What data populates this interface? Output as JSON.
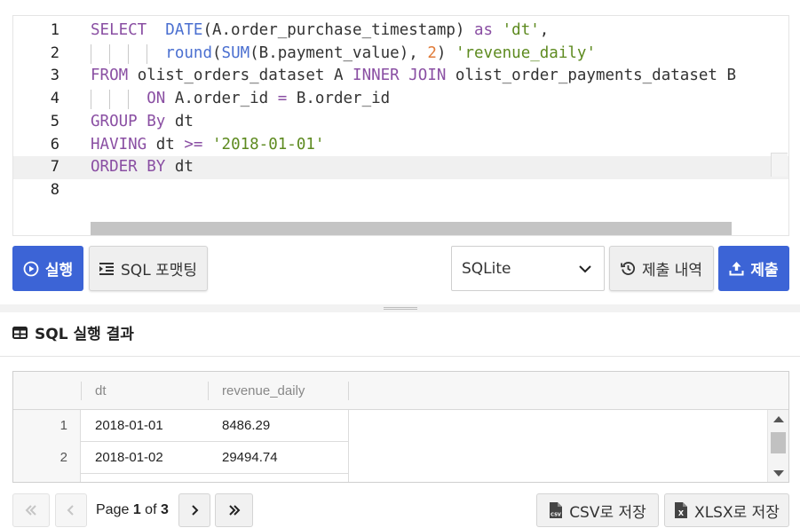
{
  "editor": {
    "active_line": 7,
    "lines": [
      {
        "num": "1",
        "tokens": [
          [
            "kw",
            "SELECT"
          ],
          [
            "",
            "  "
          ],
          [
            "fn",
            "DATE"
          ],
          [
            "",
            "(A.order_purchase_timestamp) "
          ],
          [
            "kw",
            "as"
          ],
          [
            "",
            " "
          ],
          [
            "str",
            "'dt'"
          ],
          [
            "",
            ","
          ]
        ],
        "guides": 0
      },
      {
        "num": "2",
        "tokens": [
          [
            "",
            "        "
          ],
          [
            "fn",
            "round"
          ],
          [
            "",
            "("
          ],
          [
            "fn",
            "SUM"
          ],
          [
            "",
            "(B.payment_value), "
          ],
          [
            "num",
            "2"
          ],
          [
            "",
            ") "
          ],
          [
            "str",
            "'revenue_daily'"
          ]
        ],
        "guides": 4
      },
      {
        "num": "3",
        "tokens": [
          [
            "kw",
            "FROM"
          ],
          [
            "",
            " olist_orders_dataset A "
          ],
          [
            "kw",
            "INNER JOIN"
          ],
          [
            "",
            " olist_order_payments_dataset B"
          ]
        ],
        "guides": 0
      },
      {
        "num": "4",
        "tokens": [
          [
            "",
            "      "
          ],
          [
            "kw",
            "ON"
          ],
          [
            "",
            " A.order_id "
          ],
          [
            "kw",
            "="
          ],
          [
            "",
            " B.order_id"
          ]
        ],
        "guides": 3
      },
      {
        "num": "5",
        "tokens": [
          [
            "kw",
            "GROUP By"
          ],
          [
            "",
            " dt"
          ]
        ],
        "guides": 0
      },
      {
        "num": "6",
        "tokens": [
          [
            "kw",
            "HAVING"
          ],
          [
            "",
            " dt "
          ],
          [
            "kw",
            ">="
          ],
          [
            "",
            " "
          ],
          [
            "str",
            "'2018-01-01'"
          ]
        ],
        "guides": 0
      },
      {
        "num": "7",
        "tokens": [
          [
            "kw",
            "ORDER BY"
          ],
          [
            "",
            " dt"
          ]
        ],
        "guides": 0
      },
      {
        "num": "8",
        "tokens": [],
        "guides": 0
      }
    ]
  },
  "toolbar": {
    "run_label": "실행",
    "format_label": "SQL 포맷팅",
    "dialect_selected": "SQLite",
    "history_label": "제출 내역",
    "submit_label": "제출"
  },
  "results": {
    "title": "SQL 실행 결과",
    "columns": [
      "dt",
      "revenue_daily"
    ],
    "rows": [
      {
        "num": "1",
        "dt": "2018-01-01",
        "revenue_daily": "8486.29"
      },
      {
        "num": "2",
        "dt": "2018-01-02",
        "revenue_daily": "29494.74"
      }
    ]
  },
  "pager": {
    "prefix": "Page ",
    "current": "1",
    "middle": " of ",
    "total": "3"
  },
  "export": {
    "csv_label": "CSV로 저장",
    "xlsx_label": "XLSX로 저장",
    "csv_icon_text": "CSV",
    "xlsx_icon_text": "X"
  },
  "colors": {
    "primary": "#3c64d6",
    "keyword": "#8a4fa3",
    "function": "#4a6fd0",
    "string": "#5d8a1f",
    "number": "#e07b39"
  },
  "icons": {
    "run": "play-circle-icon",
    "format": "indent-icon",
    "dropdown": "chevron-down-icon",
    "history": "history-icon",
    "submit": "upload-icon",
    "table": "table-icon",
    "first": "double-chevron-left-icon",
    "prev": "chevron-left-icon",
    "next": "chevron-right-icon",
    "last": "double-chevron-right-icon",
    "csv": "csv-file-icon",
    "xlsx": "excel-file-icon"
  }
}
